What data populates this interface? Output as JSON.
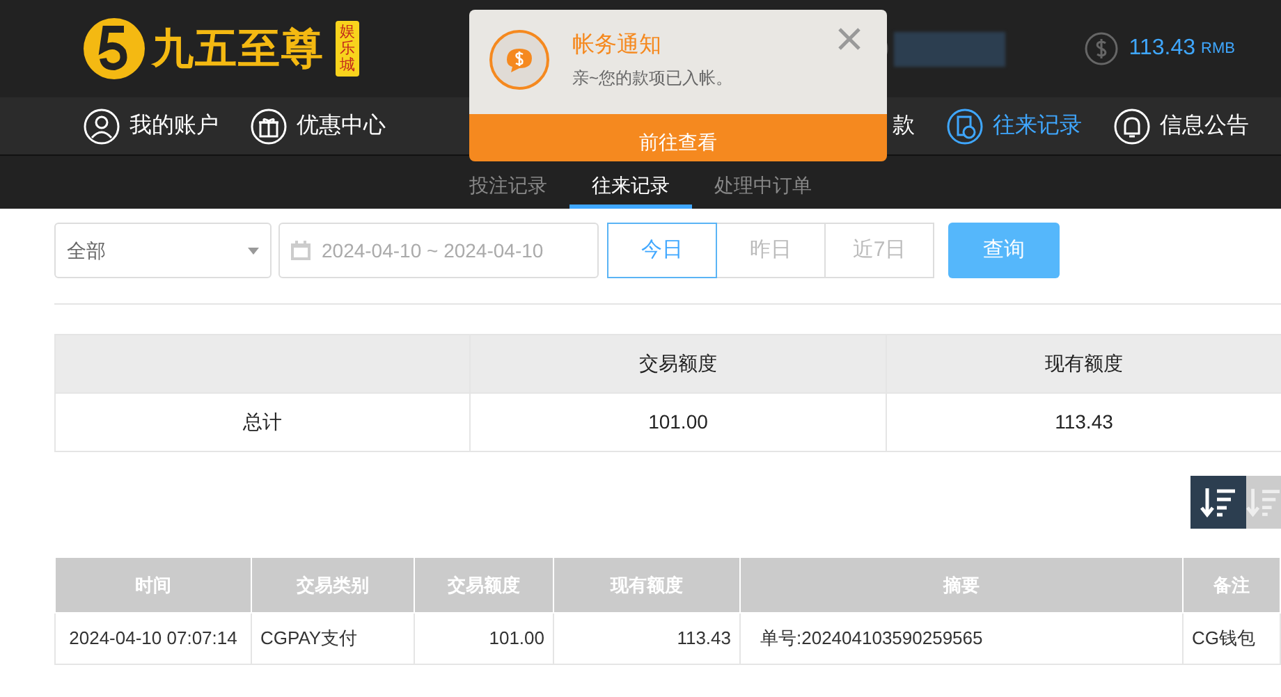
{
  "header": {
    "logo": {
      "name": "九五至尊",
      "badge": "娱乐城"
    },
    "balance": {
      "amount": "113.43",
      "currency": "RMB"
    }
  },
  "nav": [
    {
      "label": "我的账户",
      "selected": false
    },
    {
      "label": "优惠中心",
      "selected": false
    },
    {
      "label": "款",
      "selected": false,
      "kind": "covered"
    },
    {
      "label": "往来记录",
      "selected": true
    },
    {
      "label": "信息公告",
      "selected": false
    }
  ],
  "subtabs": [
    {
      "label": "投注记录",
      "selected": false
    },
    {
      "label": "往来记录",
      "selected": true
    },
    {
      "label": "处理中订单",
      "selected": false
    }
  ],
  "notification": {
    "title": "帐务通知",
    "message": "亲~您的款项已入帐。",
    "action": "前往查看"
  },
  "filters": {
    "type_select": "全部",
    "date_range": "2024-04-10 ~ 2024-04-10",
    "quick_ranges": [
      {
        "label": "今日",
        "selected": true
      },
      {
        "label": "昨日",
        "selected": false
      },
      {
        "label": "近7日",
        "selected": false
      }
    ],
    "query_button": "查询"
  },
  "summary": {
    "columns": [
      "交易额度",
      "现有额度"
    ],
    "row": {
      "label": "总计",
      "values": [
        "101.00",
        "113.43"
      ]
    }
  },
  "sort_buttons": [
    {
      "selected": true
    },
    {
      "selected": false
    }
  ],
  "records": {
    "columns": [
      "时间",
      "交易类别",
      "交易额度",
      "现有额度",
      "摘要",
      "备注"
    ],
    "rows": [
      [
        "2024-04-10 07:07:14",
        "CGPAY支付",
        "101.00",
        "113.43",
        "单号:202404103590259565",
        "CG钱包"
      ]
    ]
  }
}
